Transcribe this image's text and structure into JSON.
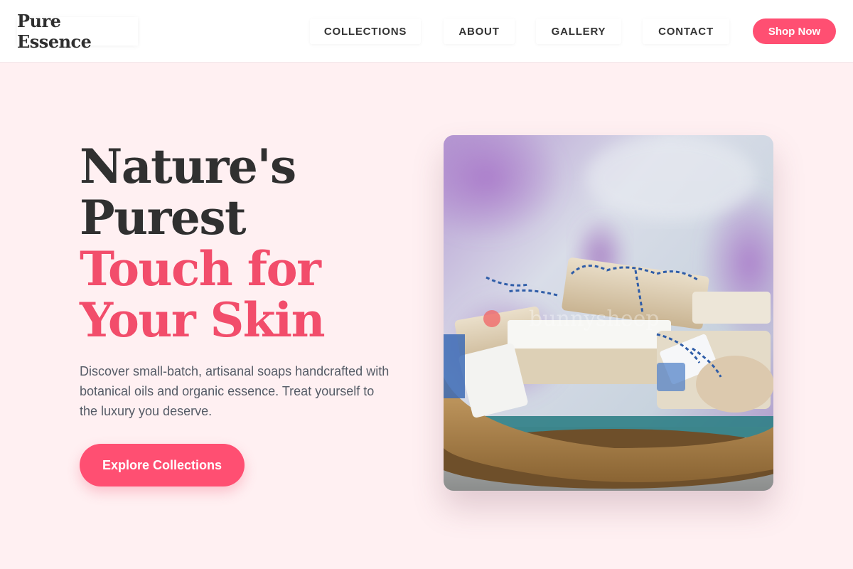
{
  "nav": {
    "logo": "Pure Essence",
    "links": [
      "COLLECTIONS",
      "ABOUT",
      "GALLERY",
      "CONTACT"
    ],
    "cta": "Shop Now"
  },
  "hero": {
    "title_line1": "Nature's",
    "title_line2": "Purest",
    "title_line3": "Touch for",
    "title_line4": "Your Skin",
    "description": "Discover small-batch, artisanal soaps handcrafted with botanical oils and organic essence. Treat yourself to the luxury you deserve.",
    "cta": "Explore Collections",
    "image_watermark": "bunnysheep"
  },
  "colors": {
    "accent": "#ff4f72",
    "accent_text": "#f24d6b",
    "background": "#fff0f2",
    "heading": "#303030",
    "body_text": "#555b66"
  }
}
